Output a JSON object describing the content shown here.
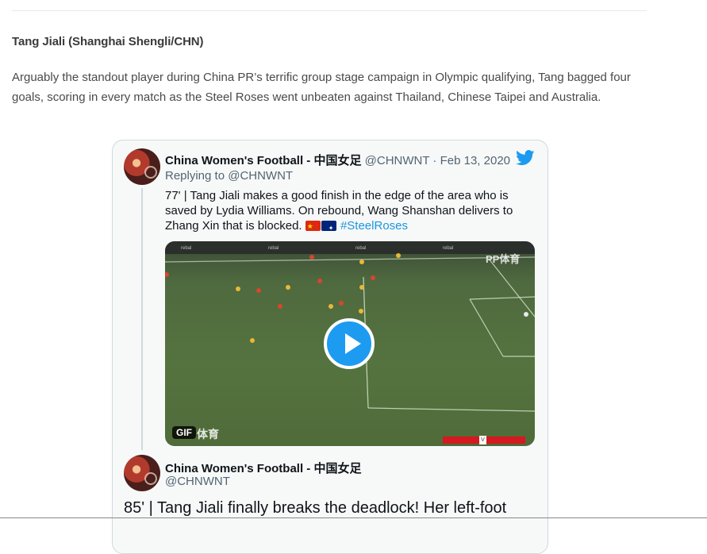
{
  "article": {
    "heading": "Tang Jiali (Shanghai Shengli/CHN)",
    "paragraph": "Arguably the standout player during China PR’s terrific group stage campaign in Olympic qualifying, Tang bagged four goals, scoring in every match as the Steel Roses went unbeaten against Thailand, Chinese Taipei and Australia."
  },
  "tweet": {
    "author_name": "China Women's Football - 中国女足",
    "handle": "@CHNWNT",
    "separator": "·",
    "date": "Feb 13, 2020",
    "replying_to": "Replying to @CHNWNT",
    "text": "77' | Tang Jiali makes a good finish in the edge of the area who is saved by Lydia Williams. On rebound, Wang Shanshan delivers to Zhang Xin that is blocked.",
    "hashtag": "#SteelRoses",
    "flags": [
      "china-flag",
      "australia-flag"
    ],
    "media": {
      "type": "gif",
      "badge": "GIF",
      "watermark_bottom": "体育",
      "watermark_top": "PP体育"
    }
  },
  "quoted_tweet": {
    "author_name": "China Women's Football - 中国女足",
    "handle": "@CHNWNT",
    "text": "85' | Tang Jiali finally breaks the deadlock! Her left-foot"
  },
  "colors": {
    "link": "#1b95e0",
    "play_button": "#1d9bf0",
    "twitter_bird": "#1d9bf0"
  }
}
